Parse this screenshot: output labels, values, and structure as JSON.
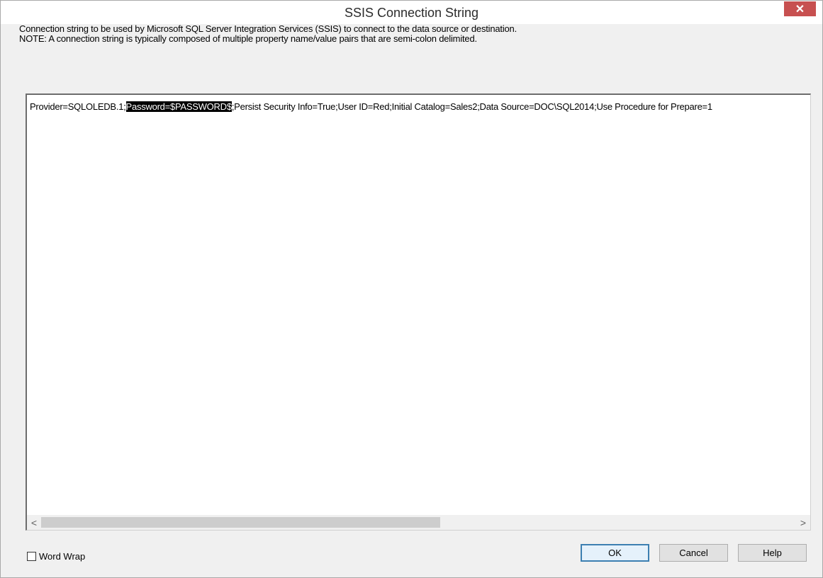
{
  "dialog": {
    "title": "SSIS Connection String",
    "close_glyph": "✕"
  },
  "description": {
    "line1": "Connection string to be used by Microsoft SQL Server Integration Services (SSIS) to connect to the data source or destination.",
    "line2": "NOTE: A connection string is typically composed of multiple property name/value pairs that are semi-colon delimited."
  },
  "connection_string": {
    "before_selection": "Provider=SQLOLEDB.1;",
    "selected": "Password=$PASSWORD$",
    "after_selection": ";Persist Security Info=True;User ID=Red;Initial Catalog=Sales2;Data Source=DOC\\SQL2014;Use Procedure for Prepare=1"
  },
  "scrollbar": {
    "left_arrow": "<",
    "right_arrow": ">"
  },
  "word_wrap": {
    "label": "Word Wrap",
    "checked": false
  },
  "buttons": {
    "ok": "OK",
    "cancel": "Cancel",
    "help": "Help"
  },
  "colors": {
    "close_button": "#c75050",
    "selection_bg": "#000000",
    "ok_button_border": "#3c7fb1"
  }
}
